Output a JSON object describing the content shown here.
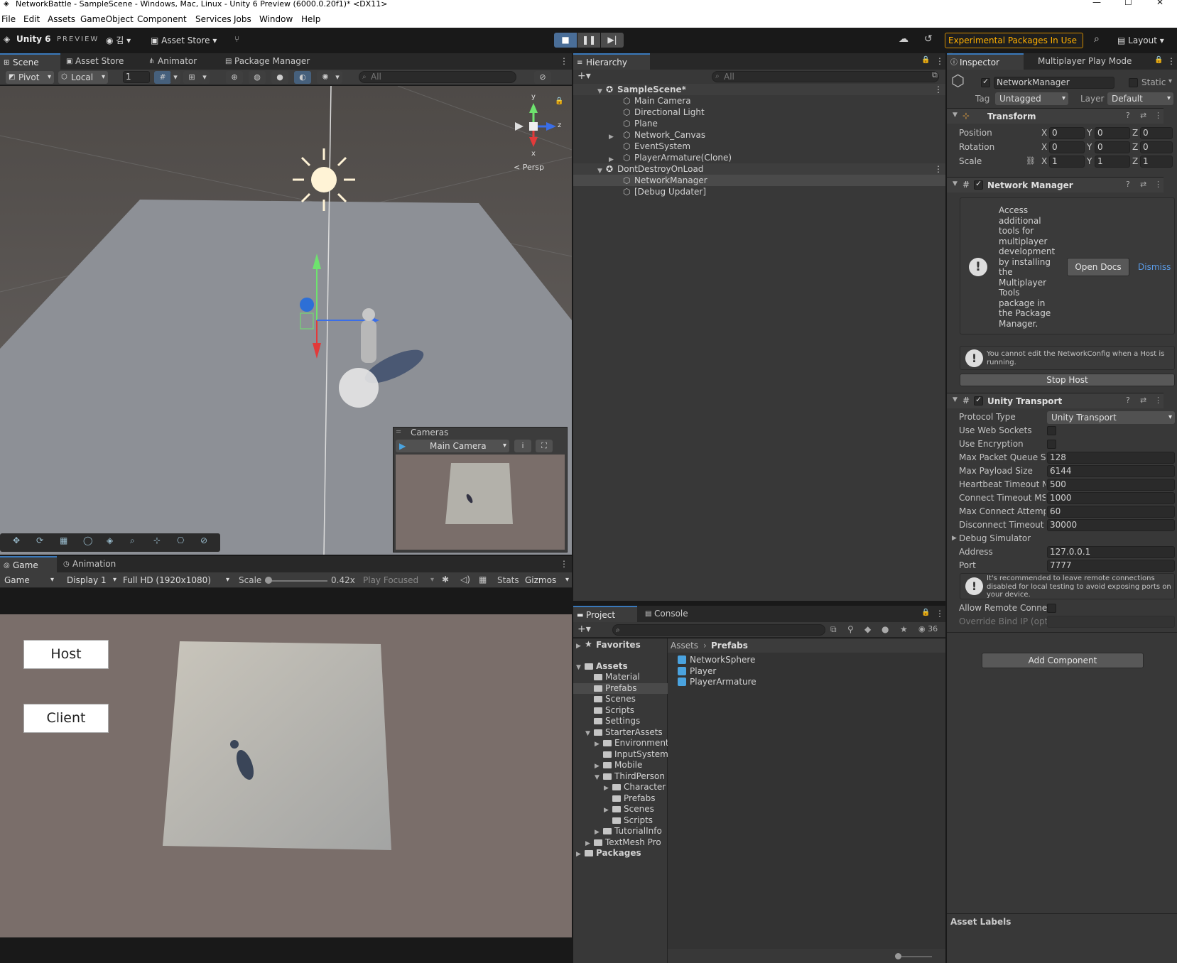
{
  "window": {
    "title": "NetworkBattle - SampleScene - Windows, Mac, Linux - Unity 6 Preview (6000.0.20f1)* <DX11>"
  },
  "menu": [
    "File",
    "Edit",
    "Assets",
    "GameObject",
    "Component",
    "Services",
    "Jobs",
    "Window",
    "Help"
  ],
  "toolbar": {
    "brand": "Unity 6",
    "preview": "PREVIEW",
    "account": "김",
    "asset_store": "Asset Store",
    "experimental": "Experimental Packages In Use",
    "layout": "Layout"
  },
  "scene_tabs": [
    "Scene",
    "Asset Store",
    "Animator",
    "Package Manager"
  ],
  "scene_toolbar": {
    "pivot": "Pivot",
    "local": "Local",
    "snap": "1",
    "search_placeholder": "All"
  },
  "gizmo": {
    "y": "y",
    "z": "z",
    "x": "x",
    "persp": "< Persp"
  },
  "cameras": {
    "title": "Cameras",
    "selected": "Main Camera"
  },
  "game_tabs": [
    "Game",
    "Animation"
  ],
  "game_toolbar": {
    "mode": "Game",
    "display": "Display 1",
    "resolution": "Full HD (1920x1080)",
    "scale_label": "Scale",
    "scale_value": "0.42x",
    "play_focused": "Play Focused",
    "stats": "Stats",
    "gizmos": "Gizmos",
    "scale_fraction": 0.0
  },
  "game_view": {
    "host": "Host",
    "client": "Client"
  },
  "hierarchy": {
    "tab": "Hierarchy",
    "search_placeholder": "All",
    "items": [
      {
        "label": "SampleScene*",
        "scene": true
      },
      {
        "label": "Main Camera"
      },
      {
        "label": "Directional Light"
      },
      {
        "label": "Plane"
      },
      {
        "label": "Network_Canvas",
        "expandable": true
      },
      {
        "label": "EventSystem"
      },
      {
        "label": "PlayerArmature(Clone)",
        "expandable": true
      },
      {
        "label": "DontDestroyOnLoad",
        "scene": true
      },
      {
        "label": "NetworkManager",
        "selected": true
      },
      {
        "label": "[Debug Updater]"
      }
    ]
  },
  "inspector": {
    "tabs": [
      "Inspector",
      "Multiplayer Play Mode"
    ],
    "object_name": "NetworkManager",
    "static_label": "Static",
    "tag_label": "Tag",
    "tag_value": "Untagged",
    "layer_label": "Layer",
    "layer_value": "Default",
    "transform": {
      "title": "Transform",
      "rows": [
        {
          "label": "Position",
          "x": "0",
          "y": "0",
          "z": "0"
        },
        {
          "label": "Rotation",
          "x": "0",
          "y": "0",
          "z": "0"
        },
        {
          "label": "Scale",
          "x": "1",
          "y": "1",
          "z": "1"
        }
      ]
    },
    "network_manager": {
      "title": "Network Manager",
      "info": "Access additional tools for multiplayer development by installing the Multiplayer Tools package in the Package Manager.",
      "open_docs": "Open Docs",
      "dismiss": "Dismiss",
      "warning": "You cannot edit the NetworkConfig when a Host is running.",
      "stop_host": "Stop Host"
    },
    "unity_transport": {
      "title": "Unity Transport",
      "protocol_label": "Protocol Type",
      "protocol_value": "Unity Transport",
      "web_sockets": "Use Web Sockets",
      "encryption": "Use Encryption",
      "fields": [
        {
          "label": "Max Packet Queue Si",
          "value": "128"
        },
        {
          "label": "Max Payload Size",
          "value": "6144"
        },
        {
          "label": "Heartbeat Timeout M",
          "value": "500"
        },
        {
          "label": "Connect Timeout MS",
          "value": "1000"
        },
        {
          "label": "Max Connect Attemp",
          "value": "60"
        },
        {
          "label": "Disconnect Timeout I",
          "value": "30000"
        }
      ],
      "debug_simulator": "Debug Simulator",
      "address_label": "Address",
      "address_value": "127.0.0.1",
      "port_label": "Port",
      "port_value": "7777",
      "remote_info": "It's recommended to leave remote connections disabled for local testing to avoid exposing ports on your device.",
      "allow_remote": "Allow Remote Conne",
      "override_bind": "Override Bind IP (opt"
    },
    "add_component": "Add Component",
    "asset_labels": "Asset Labels"
  },
  "project": {
    "tabs": [
      "Project",
      "Console"
    ],
    "count": "36",
    "tree": [
      {
        "label": "Favorites",
        "bold": true,
        "depth": 0
      },
      {
        "label": "Assets",
        "bold": true,
        "depth": 0
      },
      {
        "label": "Material",
        "depth": 1
      },
      {
        "label": "Prefabs",
        "depth": 1,
        "selected": true
      },
      {
        "label": "Scenes",
        "depth": 1
      },
      {
        "label": "Scripts",
        "depth": 1
      },
      {
        "label": "Settings",
        "depth": 1
      },
      {
        "label": "StarterAssets",
        "depth": 1
      },
      {
        "label": "Environment",
        "depth": 2
      },
      {
        "label": "InputSystem",
        "depth": 2
      },
      {
        "label": "Mobile",
        "depth": 2
      },
      {
        "label": "ThirdPerson",
        "depth": 2
      },
      {
        "label": "Character",
        "depth": 3
      },
      {
        "label": "Prefabs",
        "depth": 3
      },
      {
        "label": "Scenes",
        "depth": 3
      },
      {
        "label": "Scripts",
        "depth": 3
      },
      {
        "label": "TutorialInfo",
        "depth": 2
      },
      {
        "label": "TextMesh Pro",
        "depth": 1
      },
      {
        "label": "Packages",
        "bold": true,
        "depth": 0
      }
    ],
    "breadcrumb_root": "Assets",
    "breadcrumb_current": "Prefabs",
    "items": [
      "NetworkSphere",
      "Player",
      "PlayerArmature"
    ]
  }
}
